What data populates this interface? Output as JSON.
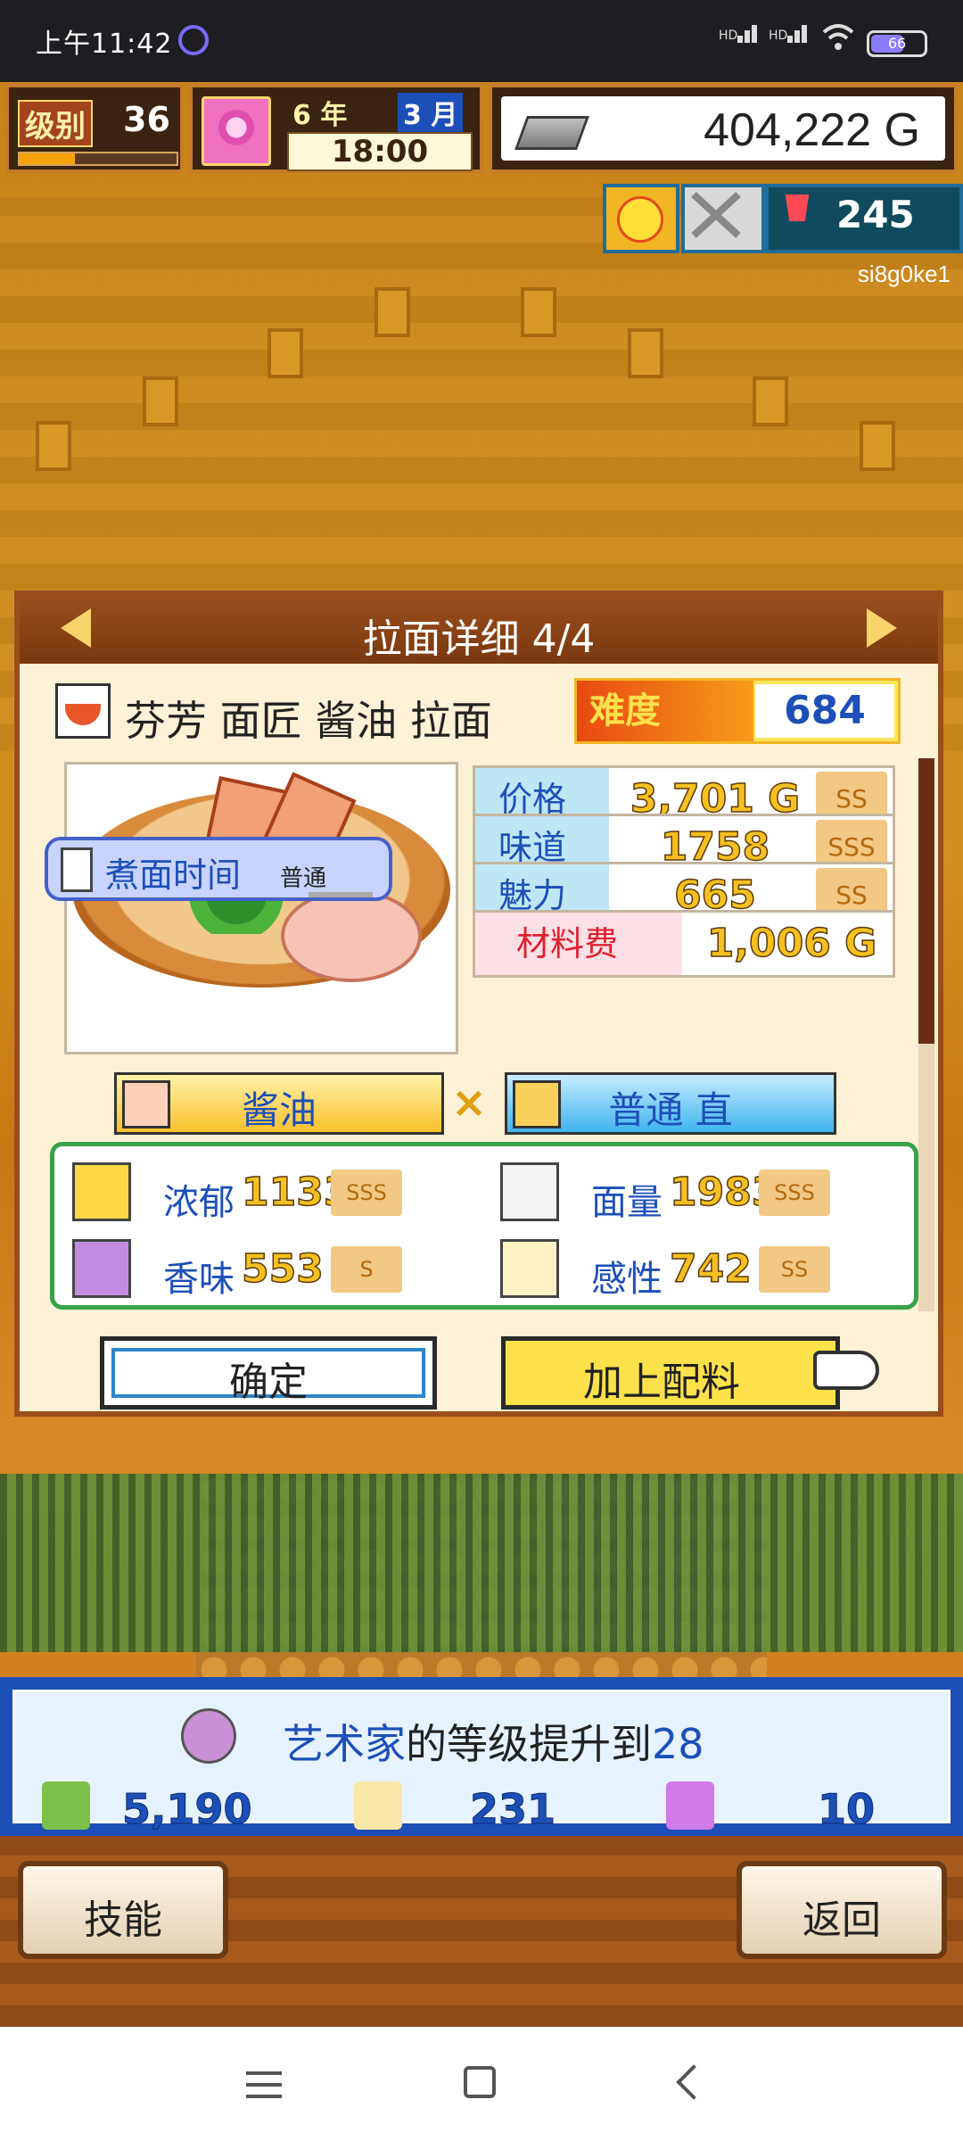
{
  "status_bar": {
    "time": "上午11:42",
    "signal1": "HD",
    "signal2": "HD",
    "battery": "66"
  },
  "hud": {
    "level_label": "级别",
    "level_value": "36",
    "level_progress": 0.35,
    "year": "6 年",
    "month": "3 月",
    "clock": "18:00",
    "money": "404,222 G",
    "population": "245",
    "user_id": "si8g0ke1"
  },
  "panel": {
    "title": "拉面详细 4/4",
    "ramen_name": "芬芳 面匠 酱油 拉面",
    "difficulty_label": "难度",
    "difficulty_value": "684",
    "boil_label": "煮面时间",
    "boil_value": "普通",
    "stats": [
      {
        "key": "价格",
        "value": "3,701 G",
        "rank": "SS"
      },
      {
        "key": "味道",
        "value": "1758",
        "rank": "SSS"
      },
      {
        "key": "魅力",
        "value": "665",
        "rank": "SS"
      },
      {
        "key": "材料费",
        "value": "1,006 G",
        "rank": ""
      }
    ],
    "soup": "酱油",
    "cross": "×",
    "noodle": "普通 直",
    "attributes": [
      {
        "key": "浓郁",
        "value": "1133",
        "rank": "SSS",
        "icon": "richness-icon"
      },
      {
        "key": "面量",
        "value": "1983",
        "rank": "SSS",
        "icon": "noodle-volume-icon"
      },
      {
        "key": "香味",
        "value": "553",
        "rank": "S",
        "icon": "aroma-icon"
      },
      {
        "key": "感性",
        "value": "742",
        "rank": "SS",
        "icon": "sensibility-icon"
      }
    ],
    "confirm": "确定",
    "add_topping": "加上配料"
  },
  "notification": {
    "role": "艺术家",
    "message": "的等级提升到",
    "level": "28",
    "money": "5,190 G",
    "spoon": "231",
    "points": "10"
  },
  "bottom": {
    "skill": "技能",
    "back": "返回"
  },
  "colors": {
    "brand_blue": "#1d4fb8",
    "panel_border": "#9a4e1c",
    "gold": "#f5c020"
  }
}
